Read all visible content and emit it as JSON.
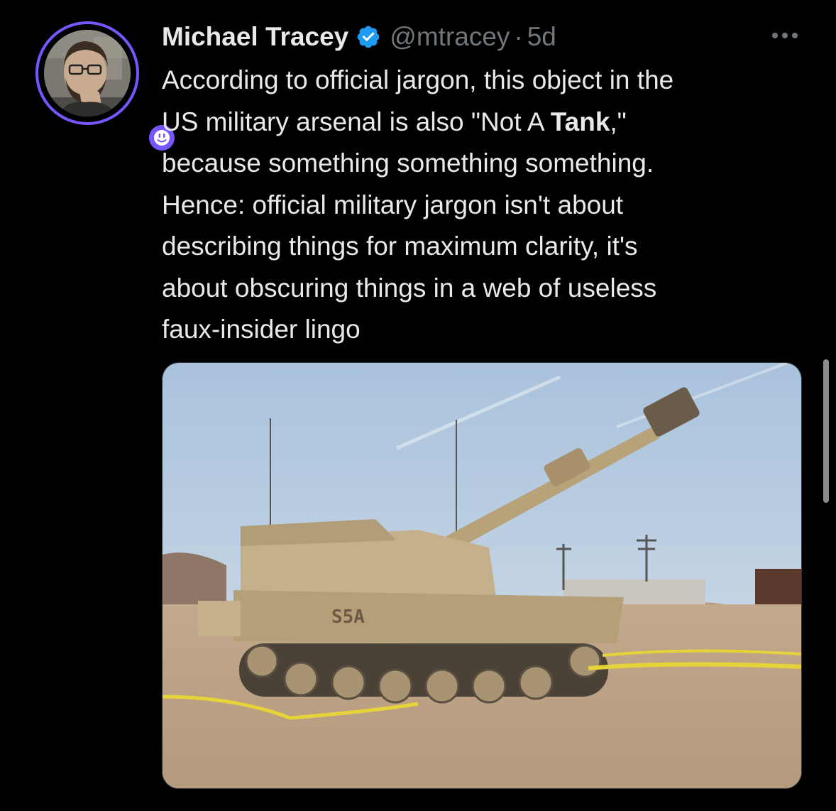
{
  "tweet": {
    "author_name": "Michael Tracey",
    "handle": "@mtracey",
    "separator": "·",
    "time": "5d",
    "text_lines": [
      "According to official jargon, this object in the",
      "US military arsenal is also \"Not A ",
      "because something something something.",
      "Hence: official military jargon isn't about",
      "describing things for maximum clarity, it's",
      "about obscuring things in a web of useless",
      "faux-insider lingo"
    ],
    "bold_word": "Tank",
    "after_bold": ",\"",
    "media_marking": "S5A"
  },
  "icons": {
    "verified": "verified-badge-icon",
    "more": "more-options-icon",
    "subscriber_badge": "smiley-badge-icon"
  },
  "colors": {
    "background": "#000000",
    "text_primary": "#e7e9ea",
    "text_secondary": "#71767b",
    "verified_blue": "#1d9bf0",
    "avatar_ring": "#7856ff"
  }
}
